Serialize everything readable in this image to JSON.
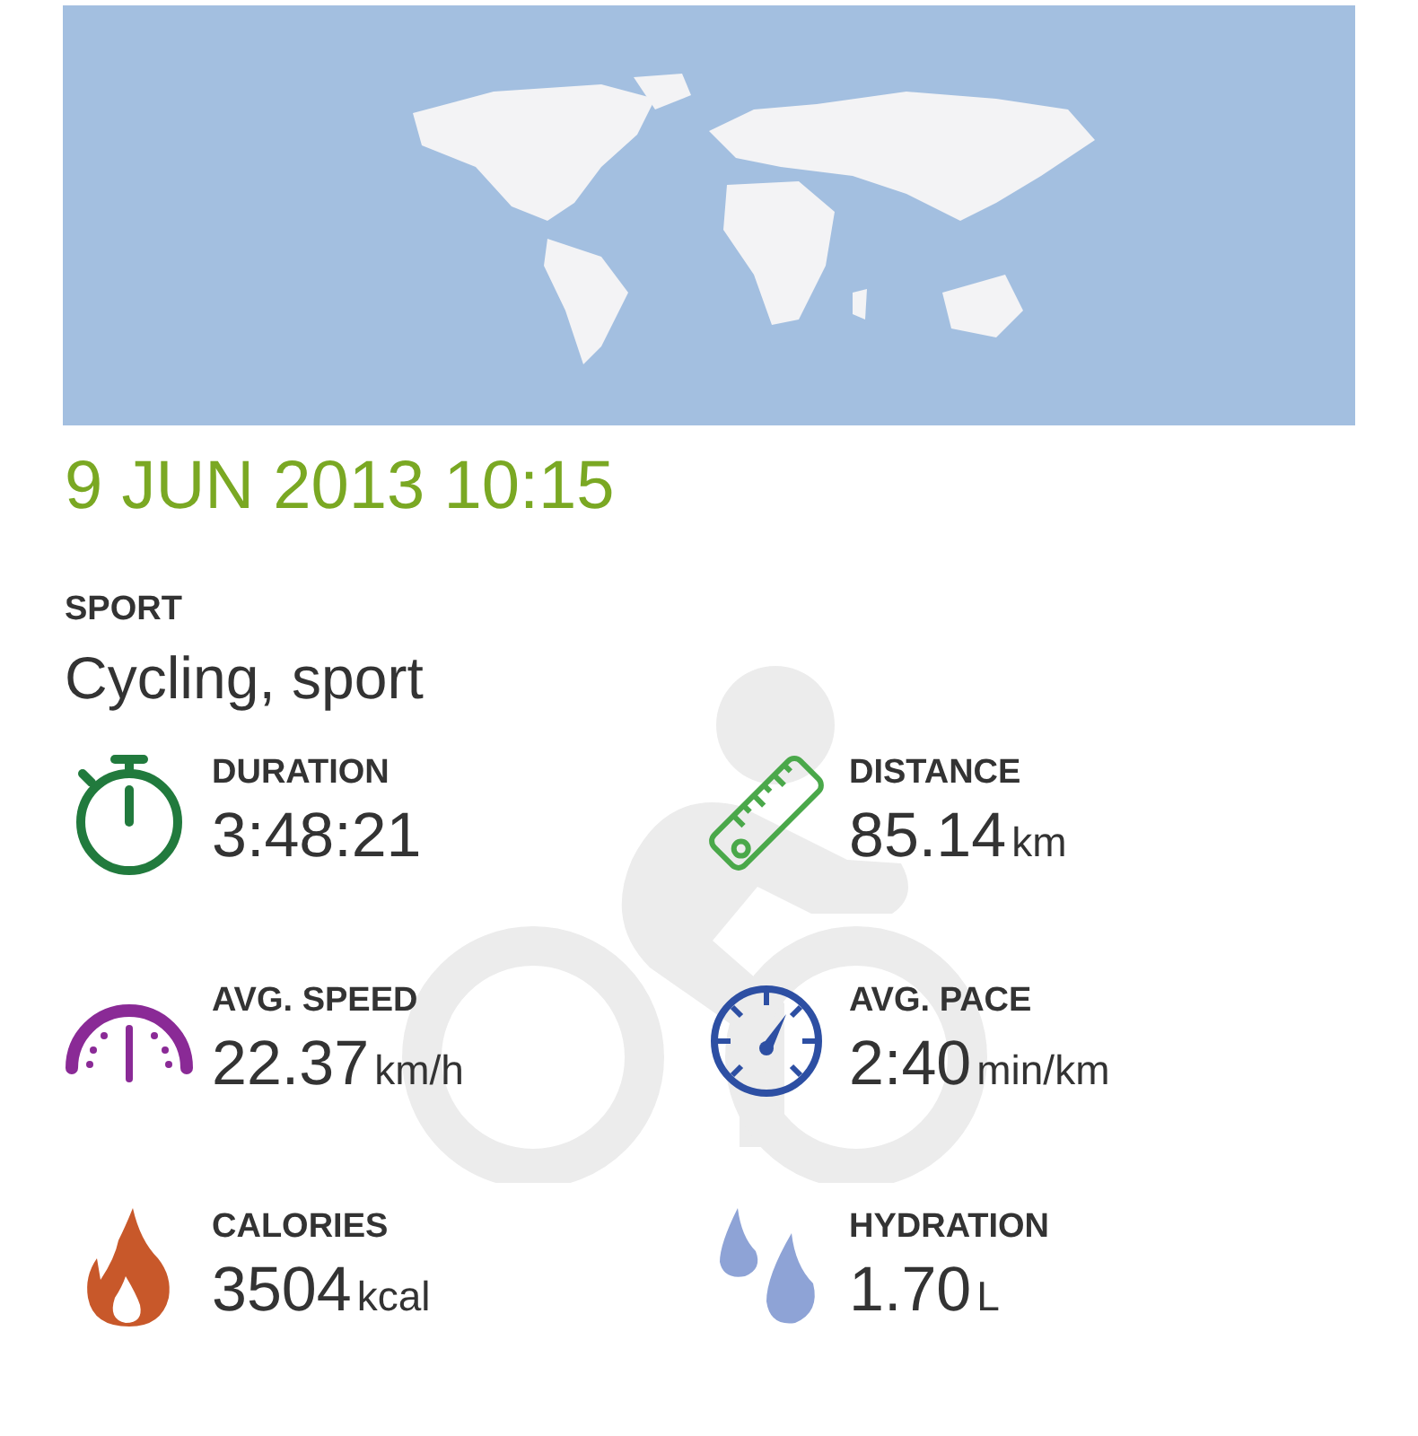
{
  "date": "9 JUN 2013 10:15",
  "sport": {
    "label": "SPORT",
    "value": "Cycling, sport"
  },
  "stats": [
    {
      "kind": "duration",
      "label": "DURATION",
      "value": "3:48:21"
    },
    {
      "kind": "distance",
      "label": "DISTANCE",
      "value": "85.14",
      "unit": "km"
    },
    {
      "kind": "speed",
      "label": "AVG. SPEED",
      "value": "22.37",
      "unit": "km/h"
    },
    {
      "kind": "pace",
      "label": "AVG. PACE",
      "value": "2:40",
      "unit": "min/km"
    },
    {
      "kind": "calories",
      "label": "CALORIES",
      "value": "3504",
      "unit": "kcal"
    },
    {
      "kind": "hydration",
      "label": "HYDRATION",
      "value": "1.70",
      "unit": "L"
    }
  ]
}
